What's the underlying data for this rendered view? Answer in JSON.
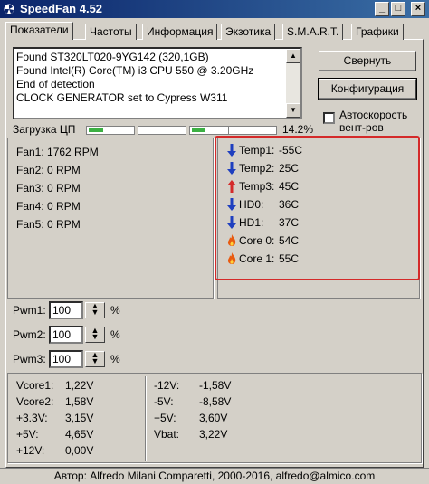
{
  "window": {
    "title": "SpeedFan 4.52",
    "buttons": {
      "minimize": "_",
      "maximize": "□",
      "close": "×"
    }
  },
  "tabs": [
    {
      "label": "Показатели",
      "active": true
    },
    {
      "label": "Частоты"
    },
    {
      "label": "Информация"
    },
    {
      "label": "Экзотика"
    },
    {
      "label": "S.M.A.R.T."
    },
    {
      "label": "Графики"
    }
  ],
  "log": {
    "lines": [
      "Found ST320LT020-9YG142 (320,1GB)",
      "Found Intel(R) Core(TM) i3 CPU 550 @ 3.20GHz",
      "End of detection",
      "CLOCK GENERATOR set to Cypress W311"
    ]
  },
  "buttons": {
    "minimize": "Свернуть",
    "configure": "Конфигурация"
  },
  "autospeed": {
    "label_line1": "Автоскорость",
    "label_line2": "вент-ров",
    "checked": false
  },
  "cpu_usage": {
    "label": "Загрузка ЦП",
    "total": "14.2%",
    "cores": [
      0.32,
      0.0,
      0.3,
      0.0
    ]
  },
  "fans": [
    "Fan1: 1762 RPM",
    "Fan2: 0 RPM",
    "Fan3: 0 RPM",
    "Fan4: 0 RPM",
    "Fan5: 0 RPM"
  ],
  "temps": [
    {
      "name": "Temp1:",
      "value": "-55C",
      "icon": "down-arrow-icon"
    },
    {
      "name": "Temp2:",
      "value": "25C",
      "icon": "down-arrow-icon"
    },
    {
      "name": "Temp3:",
      "value": "45C",
      "icon": "up-arrow-icon"
    },
    {
      "name": "HD0:",
      "value": "36C",
      "icon": "down-arrow-icon"
    },
    {
      "name": "HD1:",
      "value": "37C",
      "icon": "down-arrow-icon"
    },
    {
      "name": "Core 0:",
      "value": "54C",
      "icon": "flame-icon"
    },
    {
      "name": "Core 1:",
      "value": "55C",
      "icon": "flame-icon"
    }
  ],
  "pwm": [
    {
      "label": "Pwm1:",
      "value": "100",
      "unit": "%"
    },
    {
      "label": "Pwm2:",
      "value": "100",
      "unit": "%"
    },
    {
      "label": "Pwm3:",
      "value": "100",
      "unit": "%"
    }
  ],
  "voltages": {
    "col1": [
      {
        "name": "Vcore1:",
        "value": "1,22V"
      },
      {
        "name": "Vcore2:",
        "value": "1,58V"
      },
      {
        "name": "+3.3V:",
        "value": "3,15V"
      },
      {
        "name": "+5V:",
        "value": "4,65V"
      },
      {
        "name": "+12V:",
        "value": "0,00V"
      }
    ],
    "col2": [
      {
        "name": "-12V:",
        "value": "-1,58V"
      },
      {
        "name": "-5V:",
        "value": "-8,58V"
      },
      {
        "name": "+5V:",
        "value": "3,60V"
      },
      {
        "name": "Vbat:",
        "value": "3,22V"
      }
    ]
  },
  "status": "Автор: Alfredo Milani Comparetti, 2000-2016, alfredo@almico.com",
  "colors": {
    "highlight": "#d42a2a",
    "cpu_bar": "#3cb043",
    "arrow_down": "#1f3fbf",
    "arrow_up": "#d42a2a",
    "flame": "#e85a10"
  }
}
